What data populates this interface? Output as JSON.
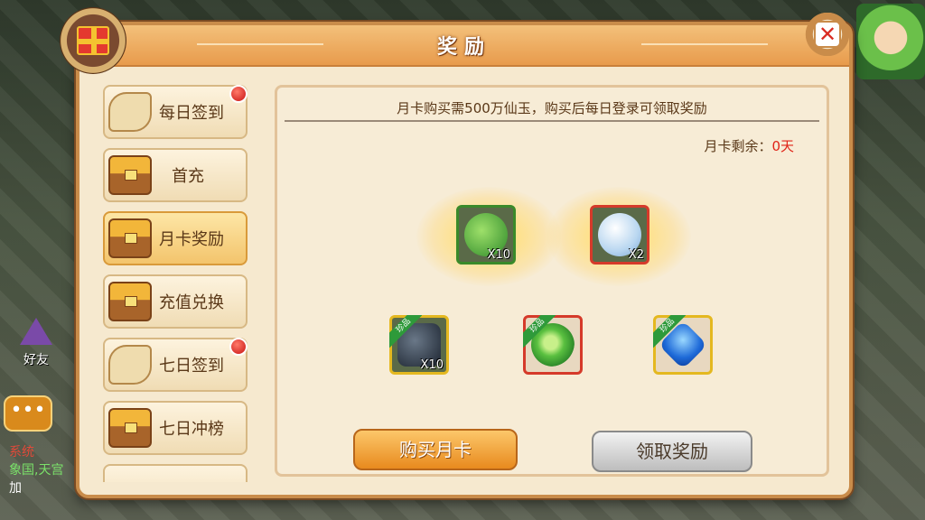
{
  "dialog": {
    "title": "奖励",
    "close_label": "✕"
  },
  "sidebar": {
    "items": [
      {
        "label": "每日签到",
        "badge": true,
        "icon": "scroll-icon"
      },
      {
        "label": "首充",
        "badge": false,
        "icon": "chest-icon"
      },
      {
        "label": "月卡奖励",
        "badge": false,
        "icon": "chest-icon",
        "active": true
      },
      {
        "label": "充值兑换",
        "badge": false,
        "icon": "chest-icon"
      },
      {
        "label": "七日签到",
        "badge": true,
        "icon": "scroll-icon"
      },
      {
        "label": "七日冲榜",
        "badge": false,
        "icon": "chest-icon"
      }
    ]
  },
  "content": {
    "notice": "月卡购买需500万仙玉，购买后每日登录可领取奖励",
    "remain_label": "月卡剩余：",
    "remain_value": "0天",
    "daily_rewards": [
      {
        "name": "green-gourd-item",
        "qty": "X10"
      },
      {
        "name": "crystal-ball-item",
        "qty": "X2"
      }
    ],
    "bonus_rewards": [
      {
        "name": "dark-ore-item",
        "qty": "X10",
        "tag": "珍品"
      },
      {
        "name": "green-jade-item",
        "qty": "",
        "tag": "珍品"
      },
      {
        "name": "blue-gem-item",
        "qty": "",
        "tag": "珍品"
      }
    ],
    "buy_button": "购买月卡",
    "claim_button": "领取奖励"
  },
  "hud": {
    "friend_label": "好友",
    "chat_sys": "系统",
    "chat_msg": "象国,天宫",
    "chat_add": "加"
  },
  "colors": {
    "accent": "#e88a1e",
    "alert": "#e02418"
  }
}
